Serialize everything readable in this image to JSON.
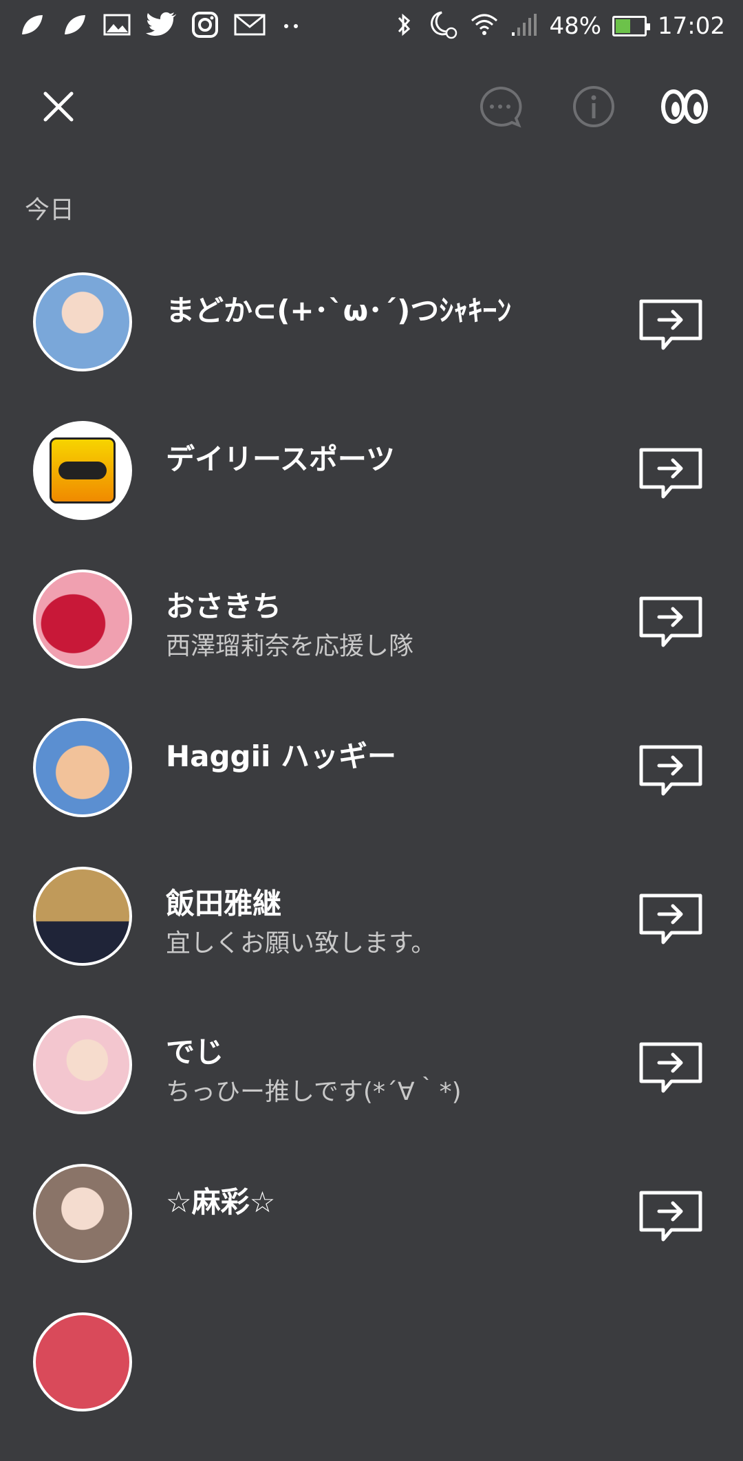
{
  "status_bar": {
    "battery": "48%",
    "time": "17:02",
    "icons": [
      "leaf-icon",
      "leaf-icon",
      "gallery-icon",
      "twitter-icon",
      "instagram-icon",
      "mail-icon",
      "more-dots-icon",
      "bluetooth-icon",
      "moon-alarm-icon",
      "wifi-icon",
      "signal-icon",
      "battery-icon"
    ]
  },
  "toolbar": {
    "icons": [
      "close-icon",
      "chat-bubble-icon",
      "info-icon",
      "eyes-icon"
    ]
  },
  "section": {
    "label": "今日"
  },
  "contacts": [
    {
      "name": "まどか⊂(+･`ω･´)つｼｬｷｰﾝ",
      "status": "",
      "avatar_color": "#7aa7d9"
    },
    {
      "name": "デイリースポーツ",
      "status": "",
      "avatar_color": "#f4c430"
    },
    {
      "name": "おさきち",
      "status": "西澤瑠莉奈を応援し隊",
      "avatar_color": "#e8506a"
    },
    {
      "name": "Haggii  ハッギー",
      "status": "",
      "avatar_color": "#5b8fd1"
    },
    {
      "name": "飯田雅継",
      "status": "宜しくお願い致します。",
      "avatar_color": "#c09a5a"
    },
    {
      "name": "でじ",
      "status": "ちっひー推しです(*´∀｀*)",
      "avatar_color": "#f3c6cf"
    },
    {
      "name": "☆麻彩☆",
      "status": "",
      "avatar_color": "#c8b2a8"
    }
  ],
  "colors": {
    "background": "#3b3c3f",
    "battery_fill": "#6cc24a"
  }
}
